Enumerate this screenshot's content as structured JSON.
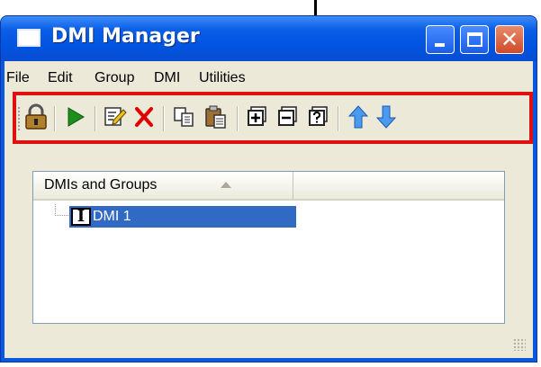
{
  "window": {
    "title": "DMI Manager"
  },
  "menubar": {
    "items": [
      "File",
      "Edit",
      "Group",
      "DMI",
      "Utilities"
    ]
  },
  "toolbar": {
    "buttons": [
      "lock-icon",
      "run-icon",
      "edit-icon",
      "delete-icon",
      "copy-icon",
      "paste-icon",
      "add-icon",
      "remove-icon",
      "help-icon",
      "move-up-icon",
      "move-down-icon"
    ]
  },
  "list": {
    "column_header": "DMIs and Groups",
    "items": [
      {
        "icon": "I",
        "label": "DMI 1",
        "selected": true
      }
    ]
  },
  "colors": {
    "titlebar": "#0a5ee8",
    "highlight_frame": "#e01010",
    "selection": "#316ac5"
  }
}
